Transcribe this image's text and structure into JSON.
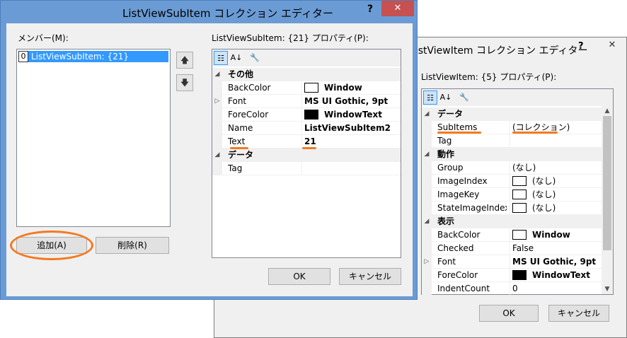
{
  "back": {
    "title": "ListViewItem コレクション エディター",
    "help": "?",
    "close": "✕",
    "prop_label": "ListViewItem: {5} プロパティ(P):",
    "ok": "OK",
    "cancel": "キャンセル",
    "rows": [
      {
        "kind": "cat",
        "name": "データ"
      },
      {
        "kind": "prop",
        "name": "SubItems",
        "value": "(コレクション)"
      },
      {
        "kind": "prop",
        "name": "Tag",
        "value": ""
      },
      {
        "kind": "cat",
        "name": "動作"
      },
      {
        "kind": "prop",
        "name": "Group",
        "value": "(なし)"
      },
      {
        "kind": "prop",
        "name": "ImageIndex",
        "value": "(なし)",
        "swatch": "#ffffff"
      },
      {
        "kind": "prop",
        "name": "ImageKey",
        "value": "(なし)",
        "swatch": "#ffffff"
      },
      {
        "kind": "prop",
        "name": "StateImageIndex",
        "value": "(なし)",
        "swatch": "#ffffff"
      },
      {
        "kind": "cat",
        "name": "表示"
      },
      {
        "kind": "prop",
        "name": "BackColor",
        "value": "Window",
        "swatch": "#ffffff",
        "bold": true
      },
      {
        "kind": "prop",
        "name": "Checked",
        "value": "False"
      },
      {
        "kind": "prop",
        "name": "Font",
        "value": "MS UI Gothic, 9pt",
        "bold": true,
        "expand": true
      },
      {
        "kind": "prop",
        "name": "ForeColor",
        "value": "WindowText",
        "swatch": "#000000",
        "bold": true
      },
      {
        "kind": "prop",
        "name": "IndentCount",
        "value": "0"
      }
    ]
  },
  "front": {
    "title": "ListViewSubItem コレクション エディター",
    "help": "?",
    "close": "✕",
    "members_label": "メンバー(M):",
    "member_index": "0",
    "member_item": "ListViewSubItem: {21}",
    "up_arrow": "🡅",
    "down_arrow": "🡇",
    "prop_label": "ListViewSubItem: {21} プロパティ(P):",
    "add": "追加(A)",
    "remove": "削除(R)",
    "ok": "OK",
    "cancel": "キャンセル",
    "rows": [
      {
        "kind": "cat",
        "name": "その他"
      },
      {
        "kind": "prop",
        "name": "BackColor",
        "value": "Window",
        "swatch": "#ffffff",
        "bold": true
      },
      {
        "kind": "prop",
        "name": "Font",
        "value": "MS UI Gothic, 9pt",
        "bold": true,
        "expand": true
      },
      {
        "kind": "prop",
        "name": "ForeColor",
        "value": "WindowText",
        "swatch": "#000000",
        "bold": true
      },
      {
        "kind": "prop",
        "name": "Name",
        "value": "ListViewSubItem2",
        "bold": true
      },
      {
        "kind": "prop",
        "name": "Text",
        "value": "21",
        "bold": true
      },
      {
        "kind": "cat",
        "name": "データ"
      },
      {
        "kind": "prop",
        "name": "Tag",
        "value": ""
      }
    ]
  },
  "toolbar_icons": {
    "categorized": "categorized-icon",
    "alphabetical": "alphabetical-sort-icon",
    "property_pages": "wrench-icon"
  },
  "highlight_color": "#f5791f"
}
